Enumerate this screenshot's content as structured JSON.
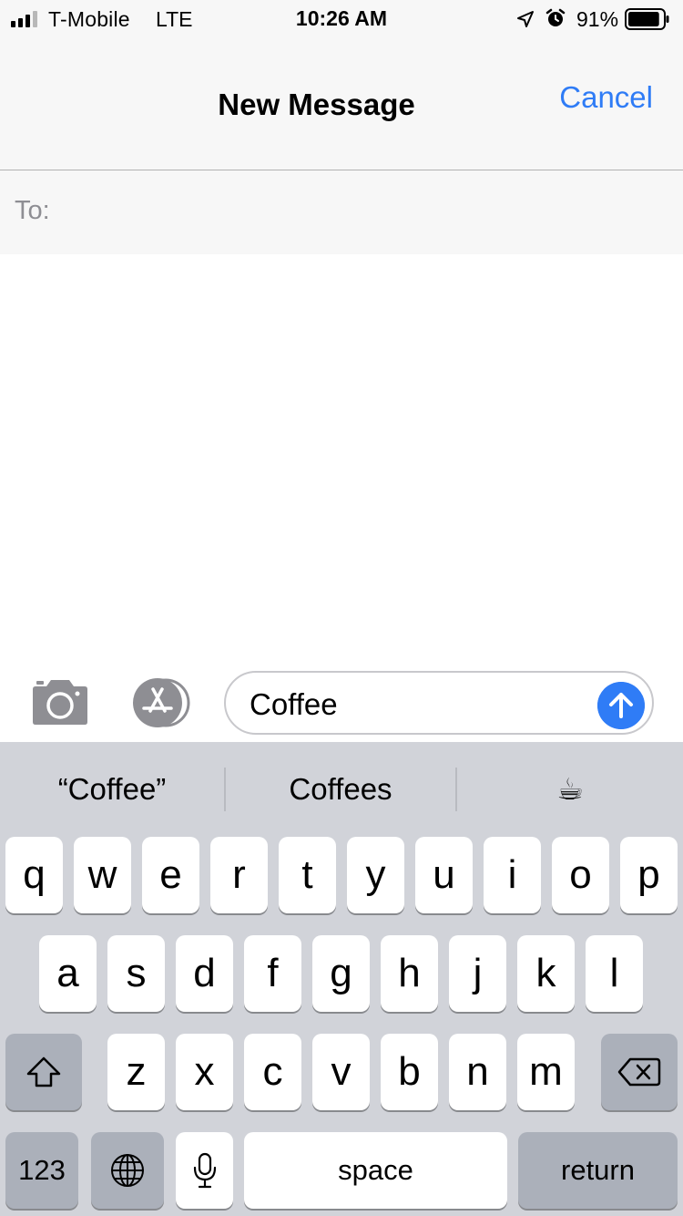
{
  "status_bar": {
    "carrier": "T-Mobile",
    "network": "LTE",
    "time": "10:26 AM",
    "battery_percent": "91%",
    "battery_level": 0.91,
    "signal_bars": 3,
    "icons": [
      "location-arrow-icon",
      "alarm-clock-icon",
      "battery-icon"
    ]
  },
  "nav": {
    "title": "New Message",
    "cancel_label": "Cancel"
  },
  "to_field": {
    "label": "To:",
    "value": ""
  },
  "compose": {
    "camera_icon": "camera-icon",
    "apps_icon": "app-store-icon",
    "text": "Coffee",
    "send_icon": "arrow-up-icon"
  },
  "keyboard": {
    "suggestions": [
      "“Coffee”",
      "Coffees",
      "☕"
    ],
    "row1": [
      "q",
      "w",
      "e",
      "r",
      "t",
      "y",
      "u",
      "i",
      "o",
      "p"
    ],
    "row2": [
      "a",
      "s",
      "d",
      "f",
      "g",
      "h",
      "j",
      "k",
      "l"
    ],
    "row3": [
      "z",
      "x",
      "c",
      "v",
      "b",
      "n",
      "m"
    ],
    "numbers_label": "123",
    "space_label": "space",
    "return_label": "return",
    "shift_icon": "shift-icon",
    "globe_icon": "globe-icon",
    "mic_icon": "microphone-icon",
    "delete_icon": "backspace-icon"
  },
  "colors": {
    "accent": "#2f7cf6",
    "keyboard_bg": "#d1d3d9",
    "special_key": "#abb0ba"
  }
}
